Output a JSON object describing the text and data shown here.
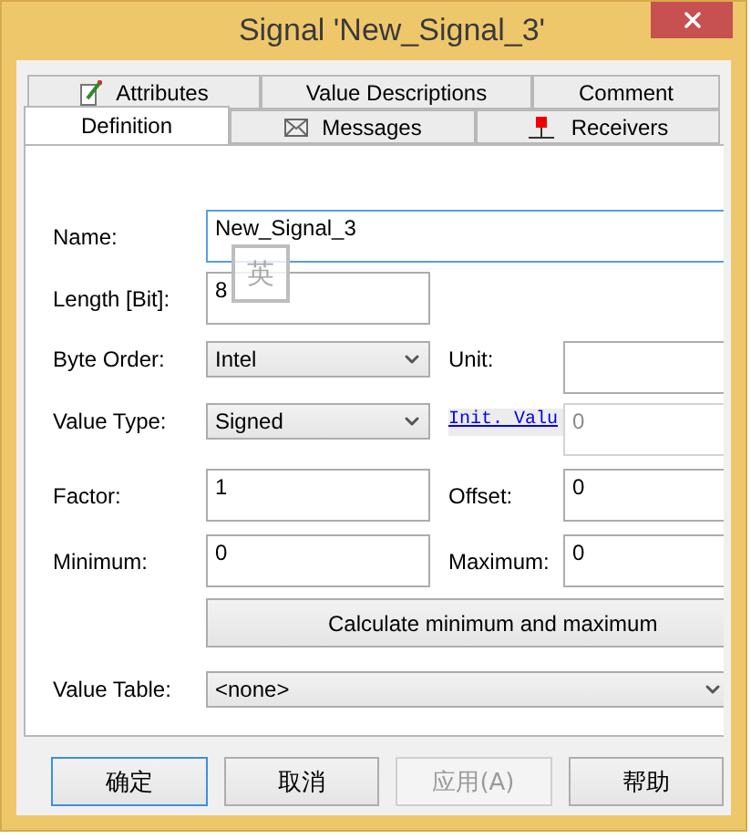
{
  "window": {
    "title": "Signal 'New_Signal_3'"
  },
  "tab_rows": [
    [
      {
        "label": "Attributes",
        "selected": false
      },
      {
        "label": "Value Descriptions",
        "selected": false
      },
      {
        "label": "Comment",
        "selected": false
      }
    ],
    [
      {
        "label": "Definition",
        "selected": true
      },
      {
        "label": "Messages",
        "selected": false
      },
      {
        "label": "Receivers",
        "selected": false
      }
    ]
  ],
  "form": {
    "name": {
      "label": "Name:",
      "value": "New_Signal_3",
      "focused": true
    },
    "ime_indicator": "英",
    "length": {
      "label": "Length [Bit]:",
      "value": "8"
    },
    "byte_order": {
      "label": "Byte Order:",
      "value": "Intel"
    },
    "unit": {
      "label": "Unit:"
    },
    "value_type": {
      "label": "Value Type:",
      "value": "Signed"
    },
    "init_value": {
      "label": "Init. Valu",
      "value": "0",
      "disabled": true
    },
    "factor": {
      "label": "Factor:",
      "value": "1"
    },
    "offset": {
      "label": "Offset:",
      "value": "0"
    },
    "minimum": {
      "label": "Minimum:",
      "value": "0"
    },
    "maximum": {
      "label": "Maximum:",
      "value": "0"
    },
    "calculate_button": "Calculate minimum and maximum",
    "value_table": {
      "label": "Value Table:",
      "value": "<none>"
    }
  },
  "buttons": [
    {
      "label": "确定",
      "focused": true,
      "disabled": false
    },
    {
      "label": "取消",
      "focused": false,
      "disabled": false
    },
    {
      "label": "应用(A)",
      "focused": false,
      "disabled": true
    },
    {
      "label": "帮助",
      "focused": false,
      "disabled": false
    }
  ]
}
